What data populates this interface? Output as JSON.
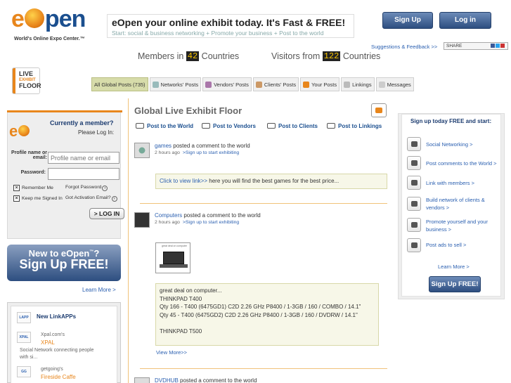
{
  "header": {
    "logo_word_1": "e",
    "logo_word_2": "pen",
    "logo_tagline": "World's Online Expo Center.™",
    "headline": "eOpen your online exhibit today. It's Fast & FREE!",
    "subline": "Start: social & business networking + Promote your business + Post to the world",
    "signup_label": "Sign Up FREE!",
    "login_label": "Log in",
    "suggestions": "Suggestions & Feedback >>",
    "share_label": "SHARE"
  },
  "stats": {
    "members_label": "Members in",
    "members_count": "42",
    "members_suffix": "Countries",
    "visitors_label": "Visitors from",
    "visitors_count": "122",
    "visitors_suffix": "Countries"
  },
  "floor_icon": [
    "LIVE",
    "EXHIBIT",
    "FLOOR"
  ],
  "tabs": [
    {
      "label": "All Global Posts (735)"
    },
    {
      "label": "Networks' Posts"
    },
    {
      "label": "Vendors' Posts"
    },
    {
      "label": "Clients' Posts"
    },
    {
      "label": "Your Posts"
    },
    {
      "label": "Linkings"
    },
    {
      "label": "Messages"
    }
  ],
  "login_box": {
    "question": "Currently a member?",
    "prompt": "Please Log In:",
    "profile_label_1": "Profile name or",
    "profile_label_2": "email:",
    "profile_placeholder": "Profile name or email",
    "password_label": "Password:",
    "remember": "Remember Me",
    "forgot": "Forgot Password",
    "keep": "Keep me Signed In",
    "activation": "Got Activation Email?",
    "button": "> LOG IN"
  },
  "new_banner": {
    "line1": "New to eOpen",
    "tm": "™",
    "q": "?",
    "line2": "Sign Up FREE!"
  },
  "learn_more_left": "Learn More >",
  "linkapps": {
    "title": "New LinkAPPs",
    "title_icon": "LAPP",
    "items": [
      {
        "icon": "XPAL",
        "owner": "Xpal.com's",
        "name": "XPAL",
        "desc1": "Social Network connecting people",
        "desc2": "with si..."
      },
      {
        "icon": "GG",
        "owner": "getgoing's",
        "name": "Fireside Caffe",
        "desc1": "",
        "desc2": ""
      }
    ]
  },
  "feed": {
    "title": "Global Live Exhibit Floor",
    "post_to": [
      "Post to the World",
      "Post to Vendors",
      "Post to Clients",
      "Post to Linkings"
    ],
    "posts": [
      {
        "user": "games",
        "action": "posted a comment to the world",
        "time": "2 hours ago",
        "cta": ">Sign up to start exhibiting",
        "link": "Click to view link>>",
        "body": " here you will find the best games for the best price..."
      },
      {
        "user": "Computers",
        "action": "posted a comment to the world",
        "time": "2 hours ago",
        "cta": ">Sign up to start exhibiting",
        "thumb_caption": "great deal on computer",
        "body": "great deal on computer...\nTHINKPAD T400\nQty 166 - T400 (6475GD1) C2D 2.26 GHz P8400 / 1-3GB / 160 / COMBO / 14.1\"\nQty 45 - T400 (6475GD2) C2D 2.26 GHz P8400 / 1-3GB / 160 / DVDRW / 14.1\"\n\nTHINKPAD T500",
        "view_more": "View More>>"
      },
      {
        "user": "DVDHUB",
        "action": "posted a comment to the world"
      }
    ]
  },
  "signup_box": {
    "heading": "Sign up today FREE and start:",
    "features": [
      "Social Networking >",
      "Post comments to the World >",
      "Link with members >",
      "Build network of clients & vendors >",
      "Promote yourself and your business >",
      "Post ads to sell >"
    ],
    "learn_more": "Learn More >",
    "button": "Sign Up FREE!"
  },
  "colors": {
    "accent_orange": "#e8861c",
    "brand_blue": "#1b4f8f",
    "link_blue": "#2a5fb0"
  }
}
